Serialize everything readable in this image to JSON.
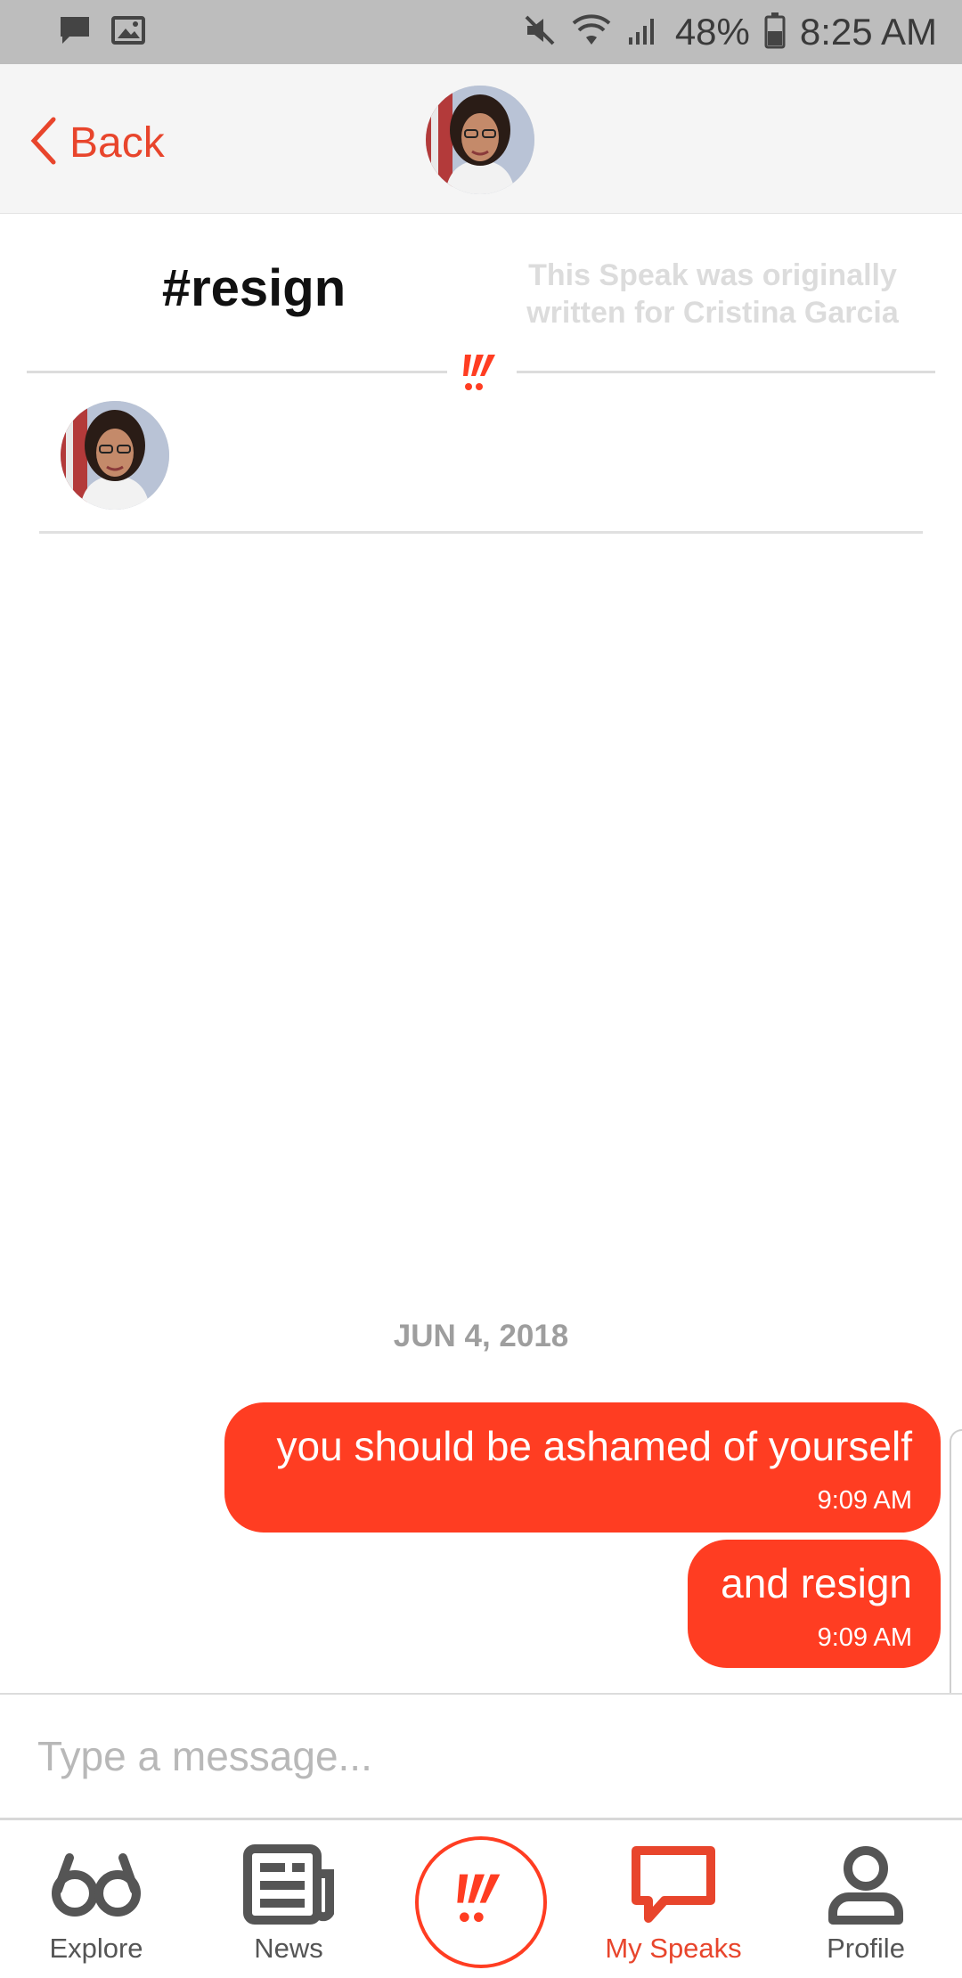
{
  "status_bar": {
    "battery": "48%",
    "time": "8:25 AM",
    "icons": [
      "message-icon",
      "image-icon",
      "mute-icon",
      "wifi-icon",
      "signal-icon",
      "battery-icon"
    ]
  },
  "header": {
    "back_label": "Back",
    "avatar": "cristina-garcia-avatar"
  },
  "speak": {
    "title": "#resign",
    "origin_note": "This Speak was originally written for Cristina Garcia",
    "recipients": [
      "cristina-garcia-avatar"
    ]
  },
  "conversation": {
    "date": "JUN 4, 2018",
    "messages": [
      {
        "text": "you should be ashamed of yourself",
        "time": "9:09 AM"
      },
      {
        "text": "and resign",
        "time": "9:09 AM"
      }
    ]
  },
  "composer": {
    "placeholder": "Type a message..."
  },
  "nav": {
    "items": [
      {
        "label": "Explore",
        "icon": "explore-icon"
      },
      {
        "label": "News",
        "icon": "news-icon"
      },
      {
        "label": "",
        "icon": "speak-logo-icon"
      },
      {
        "label": "My Speaks",
        "icon": "chat-bubble-icon",
        "active": true
      },
      {
        "label": "Profile",
        "icon": "profile-icon"
      }
    ]
  },
  "colors": {
    "accent": "#ff3d22",
    "accent_text": "#e8452c",
    "header_bg": "#f5f5f5",
    "status_bar_bg": "#bdbdbd"
  }
}
